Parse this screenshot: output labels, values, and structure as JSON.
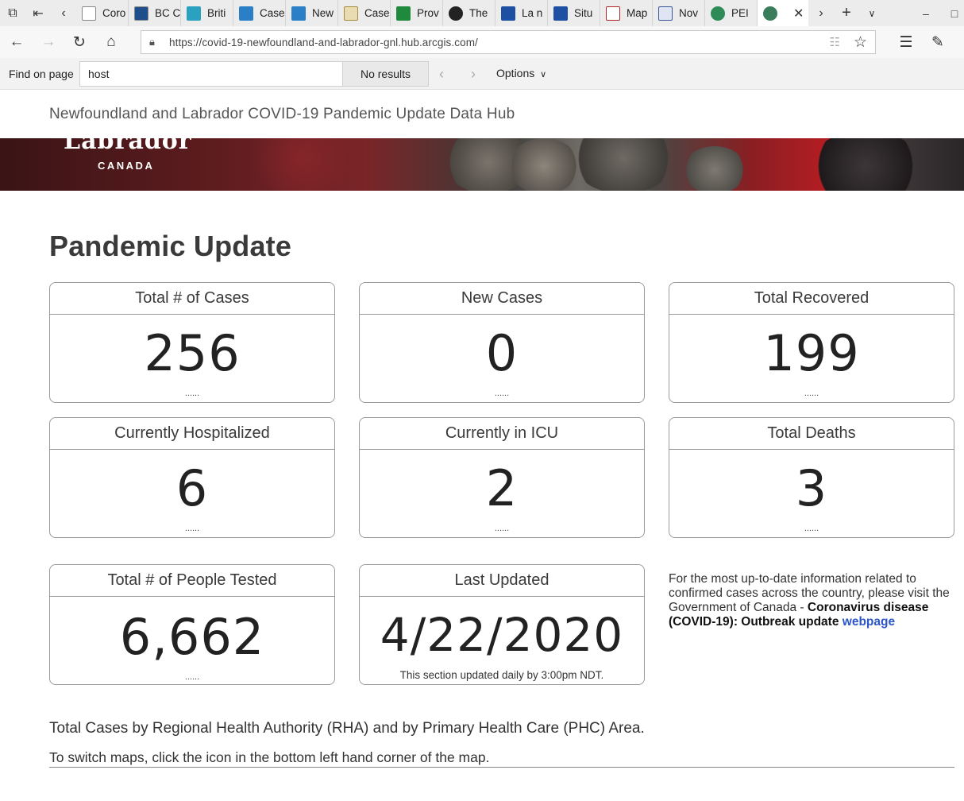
{
  "browser": {
    "tabs": [
      {
        "label": "Coro",
        "icon": "page-icon",
        "color": "#777777"
      },
      {
        "label": "BC C",
        "icon": "bc-icon",
        "color": "#1f4e8c"
      },
      {
        "label": "Briti",
        "icon": "bc-gov-icon",
        "color": "#2aa1c0"
      },
      {
        "label": "Case",
        "icon": "arcgis-icon",
        "color": "#2a7fc7"
      },
      {
        "label": "New",
        "icon": "arcgis-icon",
        "color": "#2a7fc7"
      },
      {
        "label": "Case",
        "icon": "document-icon",
        "color": "#a58b3a"
      },
      {
        "label": "Prov",
        "icon": "ontario-icon",
        "color": "#1f8a3b"
      },
      {
        "label": "The",
        "icon": "shield-icon",
        "color": "#222222"
      },
      {
        "label": "La n",
        "icon": "quebec-icon",
        "color": "#1d4fa3"
      },
      {
        "label": "Situ",
        "icon": "quebec-icon",
        "color": "#1d4fa3"
      },
      {
        "label": "Map",
        "icon": "pen-icon",
        "color": "#b0262b"
      },
      {
        "label": "Nov",
        "icon": "ns-icon",
        "color": "#3b5998"
      },
      {
        "label": "PEI",
        "icon": "pei-icon",
        "color": "#2e8b57"
      }
    ],
    "active_tab_icon": "globe-icon",
    "url": "https://covid-19-newfoundland-and-labrador-gnl.hub.arcgis.com/"
  },
  "find_bar": {
    "label": "Find on page",
    "query": "host",
    "results": "No results",
    "options_label": "Options"
  },
  "page": {
    "hub_title": "Newfoundland and Labrador COVID-19 Pandemic Update Data Hub",
    "banner": {
      "wordmark": "Labrador",
      "country": "CANADA"
    },
    "heading": "Pandemic Update",
    "cards": [
      {
        "title": "Total # of Cases",
        "value": "256",
        "footer": "......"
      },
      {
        "title": "New Cases",
        "value": "0",
        "footer": "......"
      },
      {
        "title": "Total Recovered",
        "value": "199",
        "footer": "......"
      },
      {
        "title": "Currently Hospitalized",
        "value": "6",
        "footer": "......"
      },
      {
        "title": "Currently in ICU",
        "value": "2",
        "footer": "......"
      },
      {
        "title": "Total Deaths",
        "value": "3",
        "footer": "......"
      },
      {
        "title": "Total # of People Tested",
        "value": "6,662",
        "footer": "......"
      },
      {
        "title": "Last Updated",
        "value": "4/22/2020",
        "footer": "This section updated daily by 3:00pm NDT."
      }
    ],
    "info": {
      "text": "For the most up-to-date information related to confirmed cases across the country, please visit the Government of Canada - ",
      "bold": "Coronavirus disease (COVID-19): Outbreak update",
      "link": "webpage"
    },
    "section_title": "Total Cases by Regional Health Authority (RHA) and by Primary Health Care (PHC) Area.",
    "section_sub": "To switch maps, click the icon in the bottom left hand corner of the map."
  }
}
